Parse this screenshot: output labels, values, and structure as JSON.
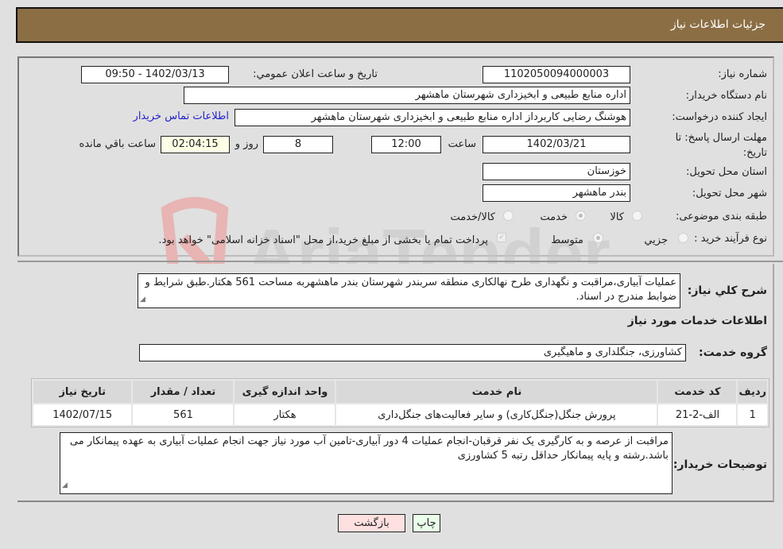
{
  "header": {
    "title": "جزئیات اطلاعات نیاز"
  },
  "fields": {
    "need_number": {
      "label": "شماره نیاز:",
      "value": "1102050094000003"
    },
    "announce_datetime": {
      "label": "تاريخ و ساعت اعلان عمومي:",
      "value": "1402/03/13 - 09:50"
    },
    "buyer_org": {
      "label": "نام دستگاه خريدار:",
      "value": "اداره منابع طبیعی و ابخیزداری شهرستان ماهشهر"
    },
    "requester": {
      "label": "ايجاد كننده درخواست:",
      "value": "هوشنگ رضایی کاربرداز اداره منابع طبیعی و ابخیزداری شهرستان ماهشهر"
    },
    "buyer_contact_link": "اطلاعات تماس خريدار",
    "deadline": {
      "label": "مهلت ارسال پاسخ: تا تاريخ:",
      "date": "1402/03/21",
      "time_label": "ساعت",
      "time": "12:00",
      "days": "8",
      "days_label": "روز و",
      "remaining": "02:04:15",
      "remaining_label": "ساعت باقي مانده"
    },
    "province": {
      "label": "استان محل تحويل:",
      "value": "خوزستان"
    },
    "city": {
      "label": "شهر محل تحويل:",
      "value": "بندر ماهشهر"
    },
    "category": {
      "label": "طبقه بندی موضوعی:",
      "options": [
        "كالا",
        "خدمت",
        "كالا/خدمت"
      ],
      "selected": "خدمت"
    },
    "purchase_type": {
      "label": "نوع فرآيند خريد :",
      "options": [
        "جزيي",
        "متوسط"
      ],
      "selected": "متوسط",
      "note": "پرداخت تمام يا بخشی از مبلغ خريد،از محل \"اسناد خزانه اسلامی\" خواهد بود."
    }
  },
  "description": {
    "label": "شرح كلي نياز:",
    "value": "عملیات آبیاری،مراقبت و نگهداری طرح نهالکاری منطقه سربندر شهرستان بندر ماهشهربه مساحت 561 هکتار.طبق شرایط و ضوابط مندرج در اسناد."
  },
  "services_section_title": "اطلاعات خدمات مورد نياز",
  "service_group": {
    "label": "گروه خدمت:",
    "value": "کشاورزی، جنگلداری و ماهیگیری"
  },
  "table": {
    "headers": [
      "رديف",
      "كد خدمت",
      "نام خدمت",
      "واحد اندازه گيری",
      "تعداد / مقدار",
      "تاريخ نياز"
    ],
    "rows": [
      [
        "1",
        "الف-2-21",
        "پرورش جنگل(جنگل‌کاری) و سایر فعالیت‌های جنگل‌داری",
        "هکتار",
        "561",
        "1402/07/15"
      ]
    ]
  },
  "buyer_notes": {
    "label": "توضيحات خريدار:",
    "value": "مراقبت از عرصه و به کارگیری یک نفر قرقبان-انجام عملیات 4 دور آبیاری-تامین آب مورد نیاز جهت انجام عملیات آبیاری به عهده پیمانکار می باشد.رشته و پایه پیمانکار حداقل رتبه 5 کشاورزی"
  },
  "buttons": {
    "print": "چاپ",
    "back": "بازگشت"
  },
  "watermark": "AriaTender.neT",
  "colors": {
    "header_bg": "#8b6e44",
    "print_bg": "#eaffea",
    "back_bg": "#ffe0e0",
    "link": "#2222cc"
  }
}
